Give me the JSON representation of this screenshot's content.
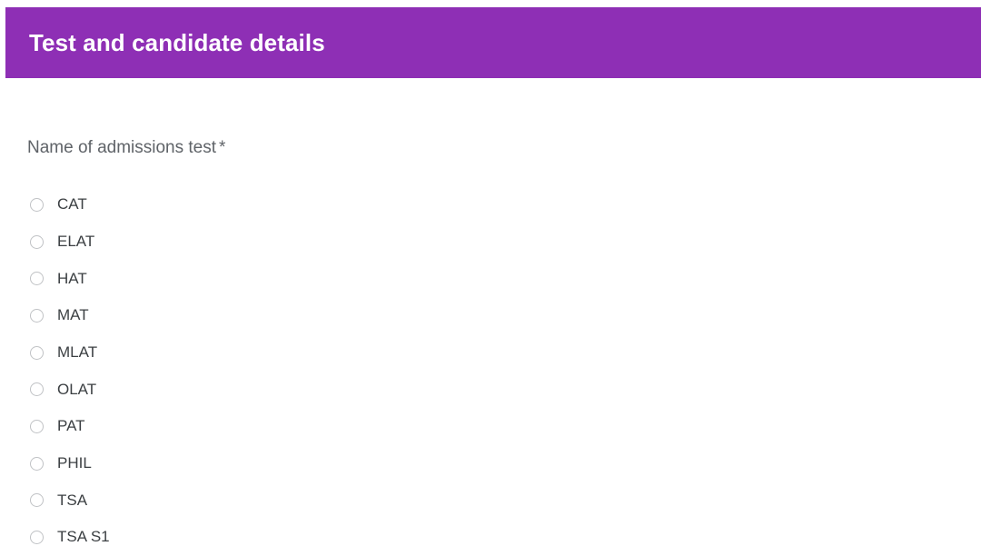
{
  "section": {
    "title": "Test and candidate details",
    "banner_color": "#8E2FB5",
    "title_color": "#FFFFFF"
  },
  "question": {
    "label": "Name of admissions test",
    "required_marker": "*",
    "label_color": "#5F6368",
    "input_type": "radio",
    "selected": null,
    "options": [
      {
        "label": "CAT",
        "selected": false
      },
      {
        "label": "ELAT",
        "selected": false
      },
      {
        "label": "HAT",
        "selected": false
      },
      {
        "label": "MAT",
        "selected": false
      },
      {
        "label": "MLAT",
        "selected": false
      },
      {
        "label": "OLAT",
        "selected": false
      },
      {
        "label": "PAT",
        "selected": false
      },
      {
        "label": "PHIL",
        "selected": false
      },
      {
        "label": "TSA",
        "selected": false
      },
      {
        "label": "TSA S1",
        "selected": false
      }
    ]
  }
}
